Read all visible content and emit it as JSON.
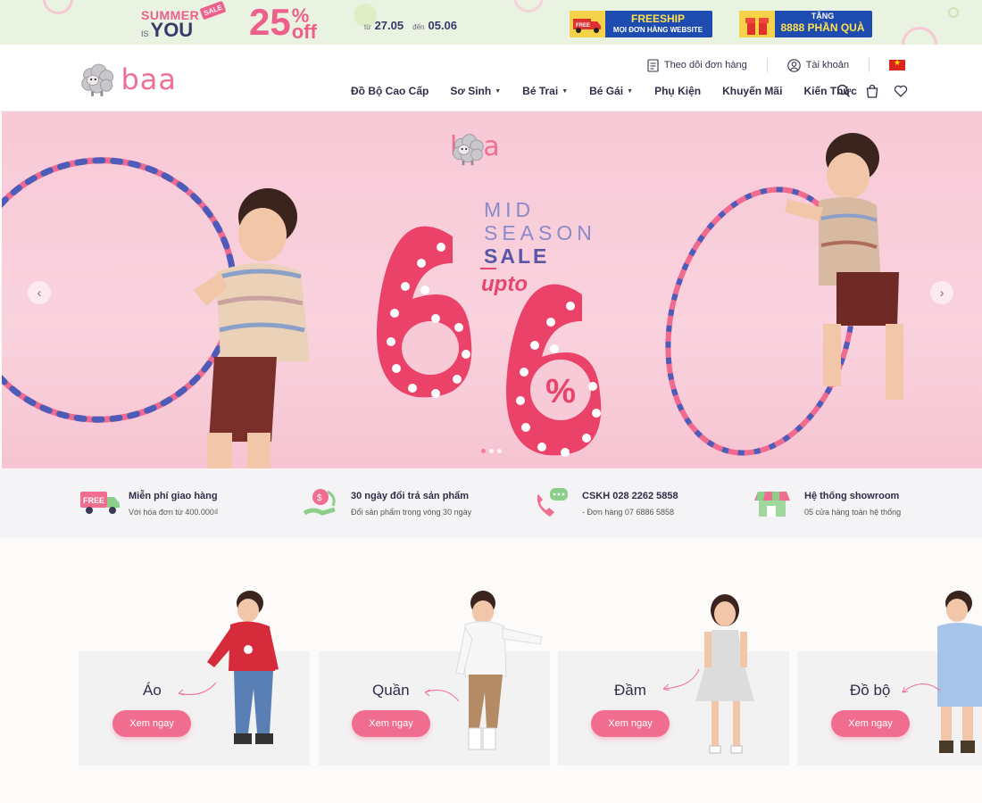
{
  "promo": {
    "summer": "SUMMER",
    "is": "IS",
    "you": "YOU",
    "sale_tag": "SALE",
    "percent": "25",
    "percent_sign": "%",
    "off": "off",
    "from_word": "từ",
    "from_date": "27.05",
    "to_word": "đến",
    "to_date": "05.06",
    "freeship_title": "FREESHIP",
    "freeship_sub": "MỌI ĐƠN HÀNG WEBSITE",
    "gift_title": "TẶNG",
    "gift_sub": "8888 PHẦN QUÀ"
  },
  "header": {
    "logo": "baa",
    "track_order": "Theo dõi đơn hàng",
    "account": "Tài khoản",
    "nav": [
      {
        "label": "Đồ Bộ Cao Cấp",
        "caret": false
      },
      {
        "label": "Sơ Sinh",
        "caret": true
      },
      {
        "label": "Bé Trai",
        "caret": true
      },
      {
        "label": "Bé Gái",
        "caret": true
      },
      {
        "label": "Phụ Kiện",
        "caret": false
      },
      {
        "label": "Khuyến Mãi",
        "caret": false
      },
      {
        "label": "Kiến Thức",
        "caret": false
      }
    ],
    "caret_glyph": "▼"
  },
  "hero": {
    "logo": "baa",
    "line1": "MID",
    "line2": "SEASON",
    "line3": "SALE",
    "upto": "upto",
    "percent_symbol": "%",
    "prev": "‹",
    "next": "›",
    "slide_count": 3,
    "active_slide": 1
  },
  "features": [
    {
      "title": "Miễn phí giao hàng",
      "sub": "Với hóa đơn từ 400.000₫",
      "icon": "free-delivery-truck-icon",
      "icon_text": "FREE"
    },
    {
      "title": "30 ngày đổi trả sản phẩm",
      "sub": "Đổi sản phẩm trong vòng 30 ngày",
      "icon": "return-exchange-icon"
    },
    {
      "title": "CSKH 028 2262 5858",
      "sub": "- Đơn hàng 07 6886 5858",
      "icon": "phone-support-icon"
    },
    {
      "title": "Hệ thống showroom",
      "sub": "05 cửa hàng toàn hệ thống",
      "icon": "storefront-icon"
    }
  ],
  "categories": [
    {
      "name": "Áo",
      "button": "Xem ngay"
    },
    {
      "name": "Quần",
      "button": "Xem ngay"
    },
    {
      "name": "Đầm",
      "button": "Xem ngay"
    },
    {
      "name": "Đồ bộ",
      "button": "Xem ngay"
    }
  ],
  "colors": {
    "brand_pink": "#ee7194",
    "button_pink": "#f06d90",
    "promo_bg": "#eaf2e2",
    "hero_bg": "#f8c9d7",
    "navy": "#2e2e48"
  }
}
